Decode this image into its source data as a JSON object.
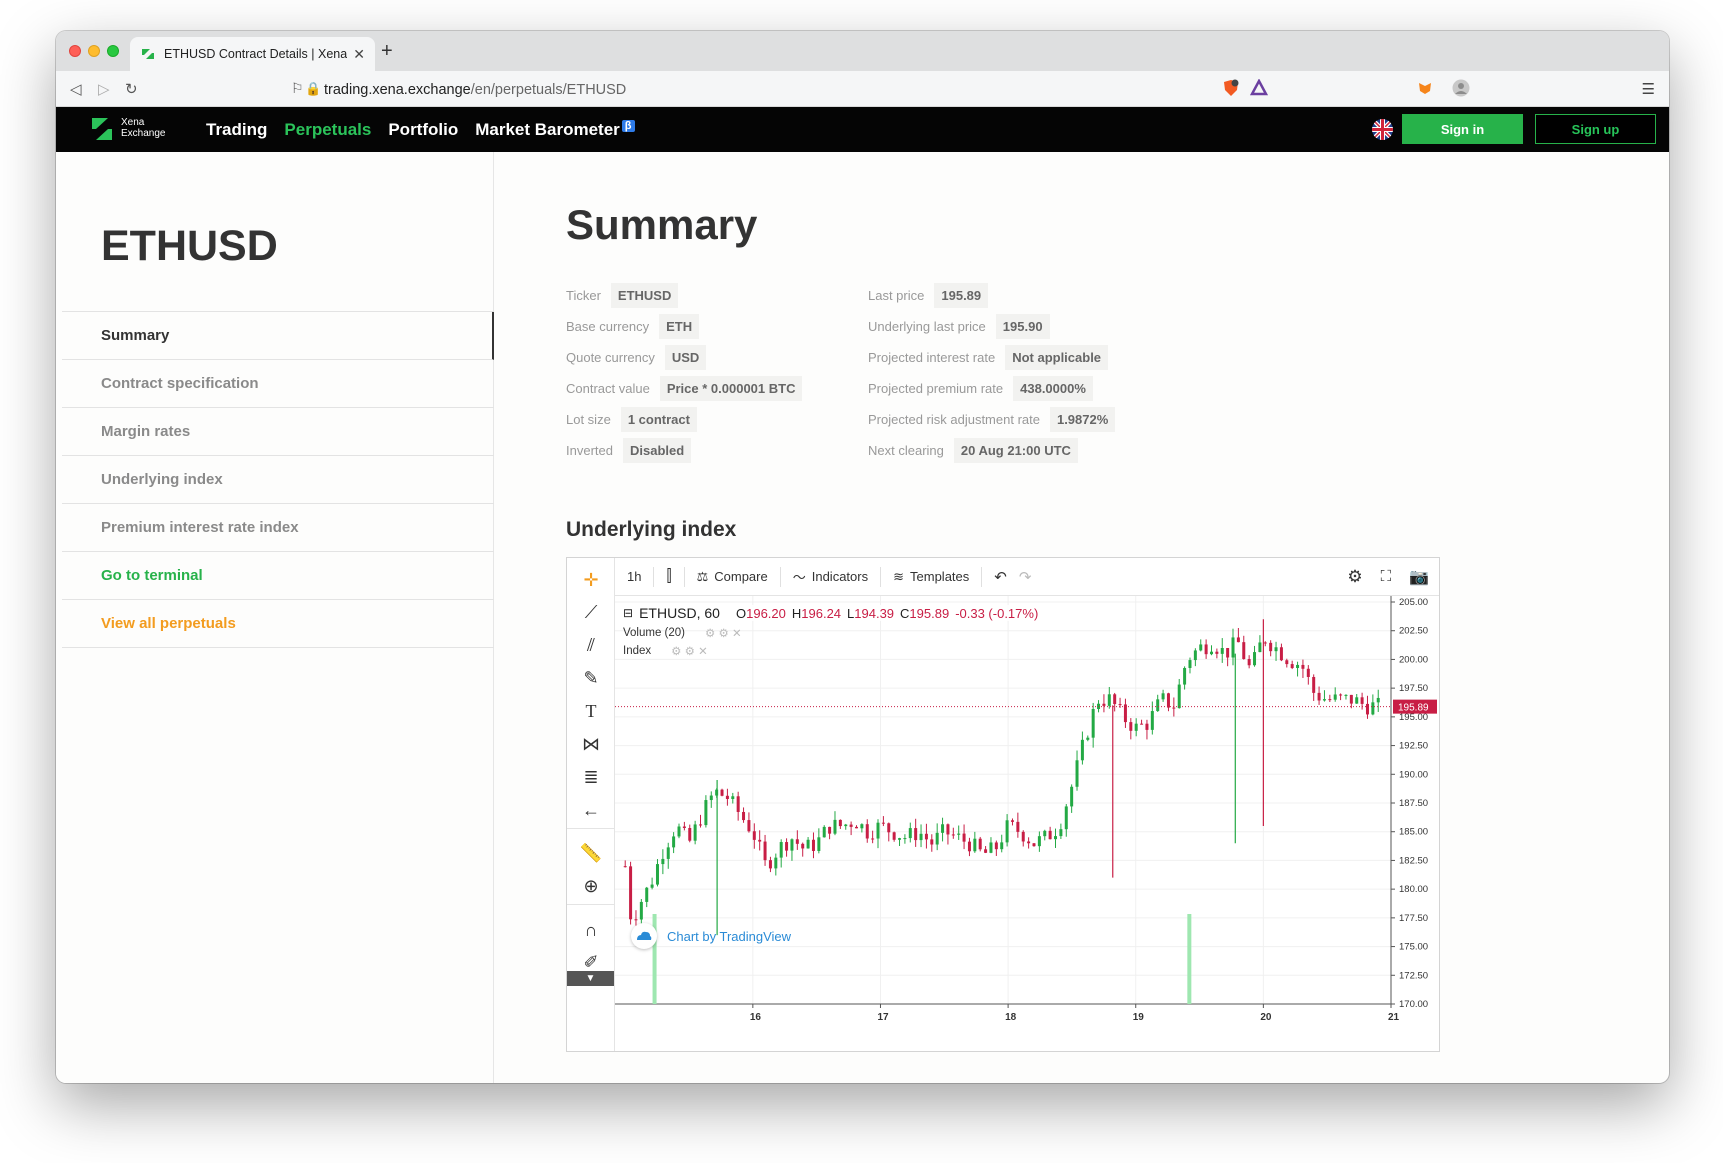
{
  "browser": {
    "tab_title": "ETHUSD Contract Details | Xena",
    "url_host": "trading.xena.exchange",
    "url_path": "/en/perpetuals/ETHUSD"
  },
  "site": {
    "logo_line1": "Xena",
    "logo_line2": "Exchange",
    "nav": [
      {
        "label": "Trading"
      },
      {
        "label": "Perpetuals"
      },
      {
        "label": "Portfolio"
      },
      {
        "label": "Market Barometer"
      }
    ],
    "beta_badge": "β",
    "signin": "Sign in",
    "signup": "Sign up",
    "accent_green": "#27b24a"
  },
  "sidebar": {
    "title": "ETHUSD",
    "items": [
      {
        "label": "Summary"
      },
      {
        "label": "Contract specification"
      },
      {
        "label": "Margin rates"
      },
      {
        "label": "Underlying index"
      },
      {
        "label": "Premium interest rate index"
      },
      {
        "label": "Go to terminal"
      },
      {
        "label": "View all perpetuals"
      }
    ]
  },
  "summary": {
    "title": "Summary",
    "left": [
      {
        "label": "Ticker",
        "value": "ETHUSD"
      },
      {
        "label": "Base currency",
        "value": "ETH"
      },
      {
        "label": "Quote currency",
        "value": "USD"
      },
      {
        "label": "Contract value",
        "value": "Price * 0.000001 BTC"
      },
      {
        "label": "Lot size",
        "value": "1 contract"
      },
      {
        "label": "Inverted",
        "value": "Disabled"
      }
    ],
    "right": [
      {
        "label": "Last price",
        "value": "195.89"
      },
      {
        "label": "Underlying last price",
        "value": "195.90"
      },
      {
        "label": "Projected interest rate",
        "value": "Not applicable"
      },
      {
        "label": "Projected premium rate",
        "value": "438.0000%"
      },
      {
        "label": "Projected risk adjustment rate",
        "value": "1.9872%"
      },
      {
        "label": "Next clearing",
        "value": "20 Aug 21:00 UTC"
      }
    ]
  },
  "underlying": {
    "title": "Underlying index"
  },
  "chart_toolbar": {
    "interval": "1h",
    "compare": "Compare",
    "indicators": "Indicators",
    "templates": "Templates"
  },
  "chart_legend": {
    "symbol": "ETHUSD, 60",
    "o_label": "O",
    "o": "196.20",
    "h_label": "H",
    "h": "196.24",
    "l_label": "L",
    "l": "194.39",
    "c_label": "C",
    "c": "195.89",
    "change": "-0.33 (-0.17%)",
    "volume": "Volume (20)",
    "index": "Index",
    "attribution": "Chart by TradingView"
  },
  "chart_data": {
    "type": "candlestick",
    "symbol": "ETHUSD, 60",
    "ylim": [
      170.0,
      205.0
    ],
    "y_ticks": [
      "205.00",
      "202.50",
      "200.00",
      "197.50",
      "195.00",
      "192.50",
      "190.00",
      "187.50",
      "185.00",
      "182.50",
      "180.00",
      "177.50",
      "175.00",
      "172.50",
      "170.00"
    ],
    "x_ticks": [
      "16",
      "17",
      "18",
      "19",
      "20",
      "21"
    ],
    "last_price": 195.89,
    "last_price_label": "195.89",
    "colors": {
      "up": "#23a944",
      "down": "#c81e45",
      "volume": "#9ee7b0"
    },
    "price_path": [
      [
        15.0,
        182.0
      ],
      [
        15.05,
        177.0
      ],
      [
        15.1,
        178.5
      ],
      [
        15.2,
        180.5
      ],
      [
        15.3,
        183.5
      ],
      [
        15.4,
        185.5
      ],
      [
        15.5,
        184.0
      ],
      [
        15.6,
        186.5
      ],
      [
        15.7,
        188.5
      ],
      [
        15.8,
        188.0
      ],
      [
        15.9,
        186.5
      ],
      [
        16.0,
        185.0
      ],
      [
        16.1,
        182.0
      ],
      [
        16.2,
        183.5
      ],
      [
        16.3,
        184.5
      ],
      [
        16.4,
        183.5
      ],
      [
        16.5,
        184.0
      ],
      [
        16.6,
        185.5
      ],
      [
        16.7,
        185.5
      ],
      [
        16.8,
        186.0
      ],
      [
        16.9,
        185.0
      ],
      [
        17.0,
        185.5
      ],
      [
        17.1,
        185.0
      ],
      [
        17.2,
        184.5
      ],
      [
        17.3,
        185.0
      ],
      [
        17.4,
        184.0
      ],
      [
        17.5,
        185.0
      ],
      [
        17.6,
        184.5
      ],
      [
        17.7,
        184.0
      ],
      [
        17.8,
        183.0
      ],
      [
        17.9,
        183.5
      ],
      [
        18.0,
        185.5
      ],
      [
        18.1,
        185.0
      ],
      [
        18.2,
        184.0
      ],
      [
        18.3,
        184.5
      ],
      [
        18.4,
        185.5
      ],
      [
        18.5,
        189.0
      ],
      [
        18.6,
        193.0
      ],
      [
        18.7,
        196.5
      ],
      [
        18.8,
        196.5
      ],
      [
        18.9,
        195.0
      ],
      [
        19.0,
        194.0
      ],
      [
        19.1,
        194.5
      ],
      [
        19.2,
        196.5
      ],
      [
        19.3,
        196.0
      ],
      [
        19.4,
        200.0
      ],
      [
        19.5,
        201.0
      ],
      [
        19.6,
        201.5
      ],
      [
        19.7,
        200.5
      ],
      [
        19.8,
        201.5
      ],
      [
        19.9,
        199.0
      ],
      [
        20.0,
        202.0
      ],
      [
        20.1,
        201.0
      ],
      [
        20.2,
        200.0
      ],
      [
        20.3,
        199.5
      ],
      [
        20.4,
        197.0
      ],
      [
        20.5,
        196.5
      ],
      [
        20.6,
        196.5
      ],
      [
        20.7,
        196.5
      ],
      [
        20.8,
        196.0
      ],
      [
        20.9,
        195.9
      ]
    ],
    "wicks": [
      {
        "x": 20.0,
        "low": 185.5,
        "high": 203.5
      },
      {
        "x": 19.78,
        "low": 184.0,
        "high": 200.5
      },
      {
        "x": 18.82,
        "low": 181.0,
        "high": 196.0
      },
      {
        "x": 15.72,
        "low": 176.0,
        "high": 189.5
      }
    ],
    "volume_bars": [
      {
        "x": 15.23,
        "value": 1.0
      },
      {
        "x": 19.42,
        "value": 1.0
      }
    ]
  }
}
